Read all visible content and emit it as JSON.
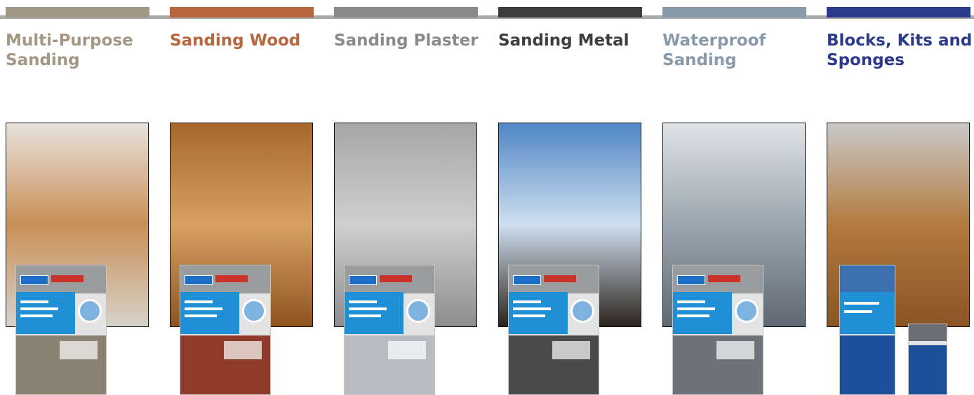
{
  "categories": [
    {
      "title": "Multi-Purpose Sanding",
      "color": "#a39886",
      "photo": {
        "top": "#e6e3dc",
        "mid": "#c98f57",
        "bottom": "#d7d2ca",
        "icon": "room-photo"
      },
      "pack_sheet": "#8a8173"
    },
    {
      "title": "Sanding Wood",
      "color": "#b8663e",
      "photo": {
        "top": "#a7672c",
        "mid": "#d8a163",
        "bottom": "#8e5420",
        "icon": "staircase-photo"
      },
      "pack_sheet": "#8f3b2b"
    },
    {
      "title": "Sanding Plaster",
      "color": "#8a8a8a",
      "photo": {
        "top": "#a6a6a6",
        "mid": "#cfcfcf",
        "bottom": "#8d8d8d",
        "icon": "drywall-photo"
      },
      "pack_sheet": "#b8bcc0"
    },
    {
      "title": "Sanding Metal",
      "color": "#3d3d3d",
      "photo": {
        "top": "#4f86c4",
        "mid": "#cfdff0",
        "bottom": "#2a231c",
        "icon": "iron-fence-photo"
      },
      "pack_sheet": "#4a4a4a"
    },
    {
      "title": "Waterproof Sanding",
      "color": "#8899aa",
      "photo": {
        "top": "#dfe3e6",
        "mid": "#9aa6b0",
        "bottom": "#5f6972",
        "icon": "car-door-handle-photo"
      },
      "pack_sheet": "#6d7378"
    },
    {
      "title": "Blocks, Kits and Sponges",
      "color": "#2b3a8a",
      "photo": {
        "top": "#c9c9c9",
        "mid": "#b27a3e",
        "bottom": "#8a5426",
        "icon": "collage-photo"
      },
      "pack_sheet": "#1e4f9a"
    }
  ]
}
